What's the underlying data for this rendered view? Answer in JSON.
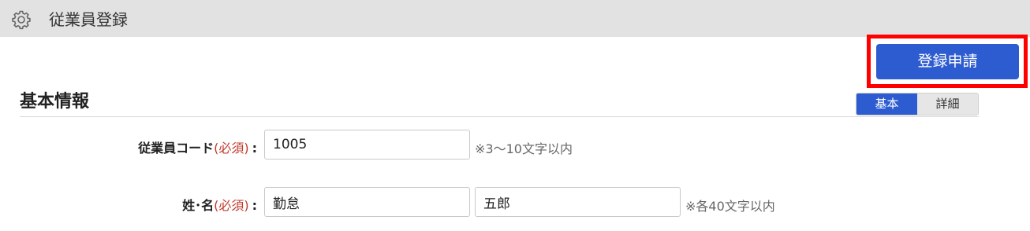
{
  "header": {
    "title": "従業員登録",
    "icon": "gear-icon"
  },
  "actions": {
    "submit_label": "登録申請",
    "accent_color": "#2d5bd0",
    "highlight_color": "#ff0000"
  },
  "section": {
    "title": "基本情報",
    "tabs": [
      {
        "label": "基本",
        "active": true
      },
      {
        "label": "詳細",
        "active": false
      }
    ]
  },
  "form": {
    "employee_code": {
      "label": "従業員コード",
      "required": "(必須)",
      "colon": ":",
      "value": "1005",
      "hint": "※3～10文字以内"
    },
    "name": {
      "label": "姓･名",
      "required": "(必須)",
      "colon": ":",
      "last_name": "勤怠",
      "first_name": "五郎",
      "hint": "※各40文字以内"
    }
  }
}
